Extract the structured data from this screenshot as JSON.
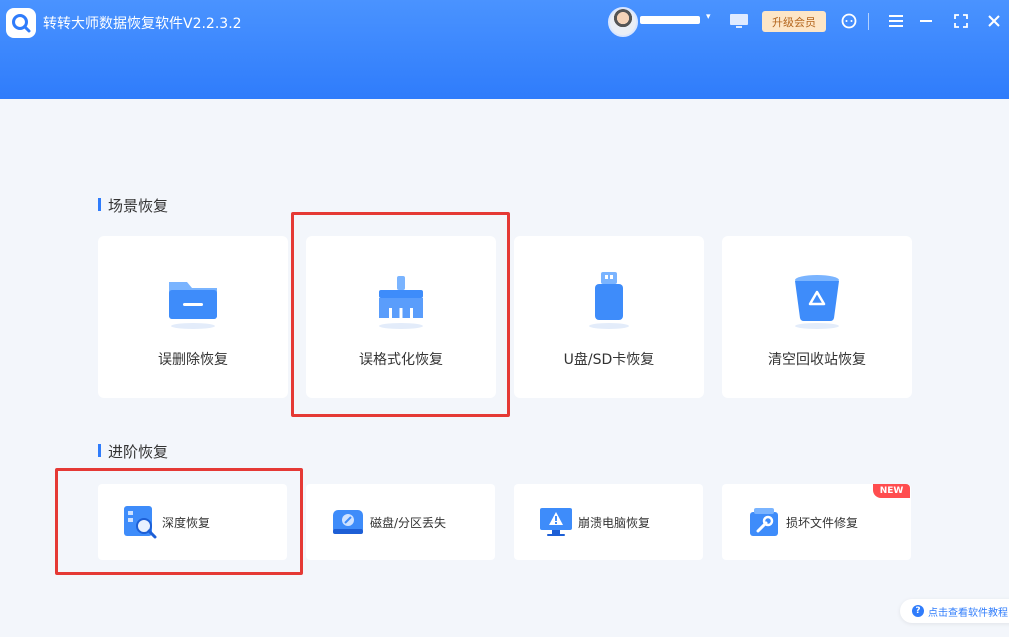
{
  "app": {
    "title": "转转大师数据恢复软件V2.2.3.2"
  },
  "header": {
    "upgrade_label": "升级会员",
    "caret": "▾"
  },
  "sections": {
    "scene": {
      "title": "场景恢复",
      "cards": [
        {
          "label": "误删除恢复",
          "icon": "folder-icon"
        },
        {
          "label": "误格式化恢复",
          "icon": "broom-icon"
        },
        {
          "label": "U盘/SD卡恢复",
          "icon": "usb-drive-icon"
        },
        {
          "label": "清空回收站恢复",
          "icon": "recycle-bin-icon"
        }
      ]
    },
    "advanced": {
      "title": "进阶恢复",
      "cards": [
        {
          "label": "深度恢复",
          "icon": "deep-scan-icon"
        },
        {
          "label": "磁盘/分区丢失",
          "icon": "disk-icon"
        },
        {
          "label": "崩溃电脑恢复",
          "icon": "crashed-computer-icon"
        },
        {
          "label": "损坏文件修复",
          "icon": "file-repair-icon",
          "badge": "NEW"
        }
      ]
    }
  },
  "help": {
    "label": "点击查看软件教程",
    "icon_glyph": "?"
  },
  "colors": {
    "accent": "#2f7cfb",
    "highlight": "#e53935",
    "badge": "#ff4d4f",
    "upgrade_bg": "#fde6c7"
  }
}
